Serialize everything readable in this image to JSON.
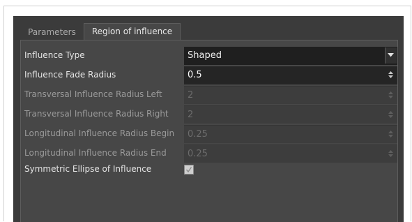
{
  "tabs": [
    {
      "label": "Parameters",
      "active": false
    },
    {
      "label": "Region of influence",
      "active": true
    }
  ],
  "fields": [
    {
      "label": "Influence Type",
      "value": "Shaped",
      "kind": "combo",
      "enabled": true
    },
    {
      "label": "Influence Fade Radius",
      "value": "0.5",
      "kind": "spin",
      "enabled": true
    },
    {
      "label": "Transversal Influence Radius Left",
      "value": "2",
      "kind": "spin",
      "enabled": false
    },
    {
      "label": "Transversal Influence Radius Right",
      "value": "2",
      "kind": "spin",
      "enabled": false
    },
    {
      "label": "Longitudinal Influence Radius Begin",
      "value": "0.25",
      "kind": "spin",
      "enabled": false
    },
    {
      "label": "Longitudinal Influence Radius End",
      "value": "0.25",
      "kind": "spin",
      "enabled": false
    }
  ],
  "checkbox": {
    "label": "Symmetric Ellipse of Influence",
    "checked": true,
    "enabled": false
  },
  "colors": {
    "panel_bg": "#3b3b3b",
    "content_bg": "#474747",
    "field_bg": "#252525",
    "field_disabled_bg": "#3d3d3d"
  },
  "icons": {
    "combo_arrow": "triangle-down-icon",
    "spin_arrows": "spin-updown-icon",
    "check": "checkmark-icon"
  }
}
